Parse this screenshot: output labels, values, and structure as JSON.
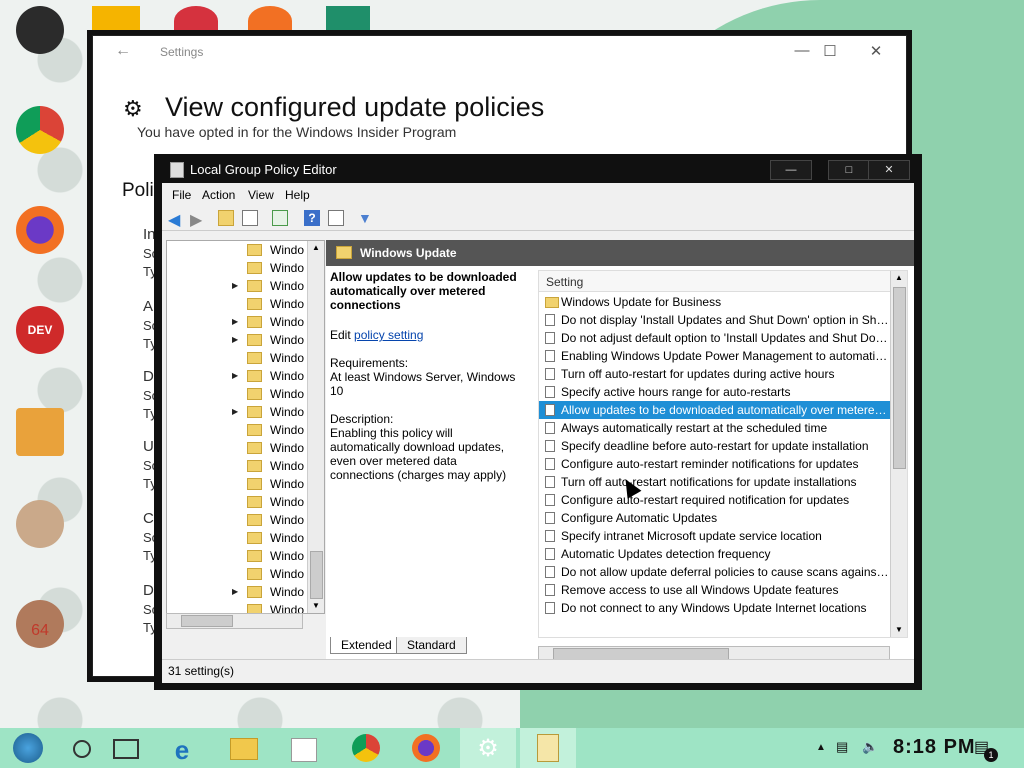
{
  "settings": {
    "window_title": "Settings",
    "heading": "View configured update policies",
    "insider_text": "You have opted in for the Windows Insider Program",
    "section_partial": "Polici",
    "fragments": [
      "In",
      "Sc",
      "Ty",
      "A",
      "Sc",
      "Ty",
      "D",
      "Sc",
      "Ty",
      "U",
      "Sc",
      "Ty",
      "C",
      "Sc",
      "Ty",
      "D",
      "Sc",
      "Ty"
    ]
  },
  "gpe": {
    "title": "Local Group Policy Editor",
    "menu": [
      "File",
      "Action",
      "View",
      "Help"
    ],
    "tree_items": [
      {
        "label": "Windo",
        "expandable": false
      },
      {
        "label": "Windo",
        "expandable": false
      },
      {
        "label": "Windo",
        "expandable": true
      },
      {
        "label": "Windo",
        "expandable": false
      },
      {
        "label": "Windo",
        "expandable": true
      },
      {
        "label": "Windo",
        "expandable": true
      },
      {
        "label": "Windo",
        "expandable": false
      },
      {
        "label": "Windo",
        "expandable": true
      },
      {
        "label": "Windo",
        "expandable": false
      },
      {
        "label": "Windo",
        "expandable": true
      },
      {
        "label": "Windo",
        "expandable": false
      },
      {
        "label": "Windo",
        "expandable": false
      },
      {
        "label": "Windo",
        "expandable": false
      },
      {
        "label": "Windo",
        "expandable": false
      },
      {
        "label": "Windo",
        "expandable": false
      },
      {
        "label": "Windo",
        "expandable": false
      },
      {
        "label": "Windo",
        "expandable": false
      },
      {
        "label": "Windo",
        "expandable": false
      },
      {
        "label": "Windo",
        "expandable": false
      },
      {
        "label": "Windo",
        "expandable": true
      },
      {
        "label": "Windo",
        "expandable": false
      },
      {
        "label": "Windo",
        "expandable": true,
        "selected": true
      }
    ],
    "content_title": "Windows Update",
    "policy_title": "Allow updates to be downloaded automatically over metered connections",
    "edit_prefix": "Edit",
    "edit_link": "policy setting",
    "requirements_label": "Requirements:",
    "requirements_value": "At least Windows Server, Windows 10",
    "description_label": "Description:",
    "description_value": "Enabling this policy will automatically download updates, even over metered data connections (charges may apply)",
    "list_header": "Setting",
    "settings": [
      {
        "label": "Windows Update for Business",
        "type": "folder"
      },
      {
        "label": "Do not display 'Install Updates and Shut Down' option in Shut Dow...",
        "type": "policy"
      },
      {
        "label": "Do not adjust default option to 'Install Updates and Shut Down' in S...",
        "type": "policy"
      },
      {
        "label": "Enabling Windows Update Power Management to automatically wa...",
        "type": "policy"
      },
      {
        "label": "Turn off auto-restart for updates during active hours",
        "type": "policy"
      },
      {
        "label": "Specify active hours range for auto-restarts",
        "type": "policy"
      },
      {
        "label": "Allow updates to be downloaded automatically over metered conn...",
        "type": "policy",
        "selected": true
      },
      {
        "label": "Always automatically restart at the scheduled time",
        "type": "policy"
      },
      {
        "label": "Specify deadline before auto-restart for update installation",
        "type": "policy"
      },
      {
        "label": "Configure auto-restart reminder notifications for updates",
        "type": "policy"
      },
      {
        "label": "Turn off auto-restart notifications for update installations",
        "type": "policy"
      },
      {
        "label": "Configure auto-restart required notification for updates",
        "type": "policy"
      },
      {
        "label": "Configure Automatic Updates",
        "type": "policy"
      },
      {
        "label": "Specify intranet Microsoft update service location",
        "type": "policy"
      },
      {
        "label": "Automatic Updates detection frequency",
        "type": "policy"
      },
      {
        "label": "Do not allow update deferral policies to cause scans against Windo...",
        "type": "policy"
      },
      {
        "label": "Remove access to use all Windows Update features",
        "type": "policy"
      },
      {
        "label": "Do not connect to any Windows Update Internet locations",
        "type": "policy"
      }
    ],
    "tabs": [
      "Extended",
      "Standard"
    ],
    "status": "31 setting(s)"
  },
  "desktop_icons": [
    {
      "label": "",
      "color": "#2b2b2b"
    },
    {
      "label": "",
      "color": "#e8453c"
    },
    {
      "label": "",
      "color": "#f27023"
    },
    {
      "label": "",
      "color": "#cf2a2a"
    },
    {
      "label": "",
      "color": "#e9a23b"
    },
    {
      "label": "",
      "color": "#caa98a"
    },
    {
      "label": "64",
      "color": "#b07a5c"
    }
  ],
  "taskbar": {
    "clock": "8:18 PM",
    "notification_count": "1"
  },
  "colors": {
    "taskbar": "#9ee4c5",
    "selection": "#1f8fd6",
    "squid": "#8fd1ad"
  }
}
